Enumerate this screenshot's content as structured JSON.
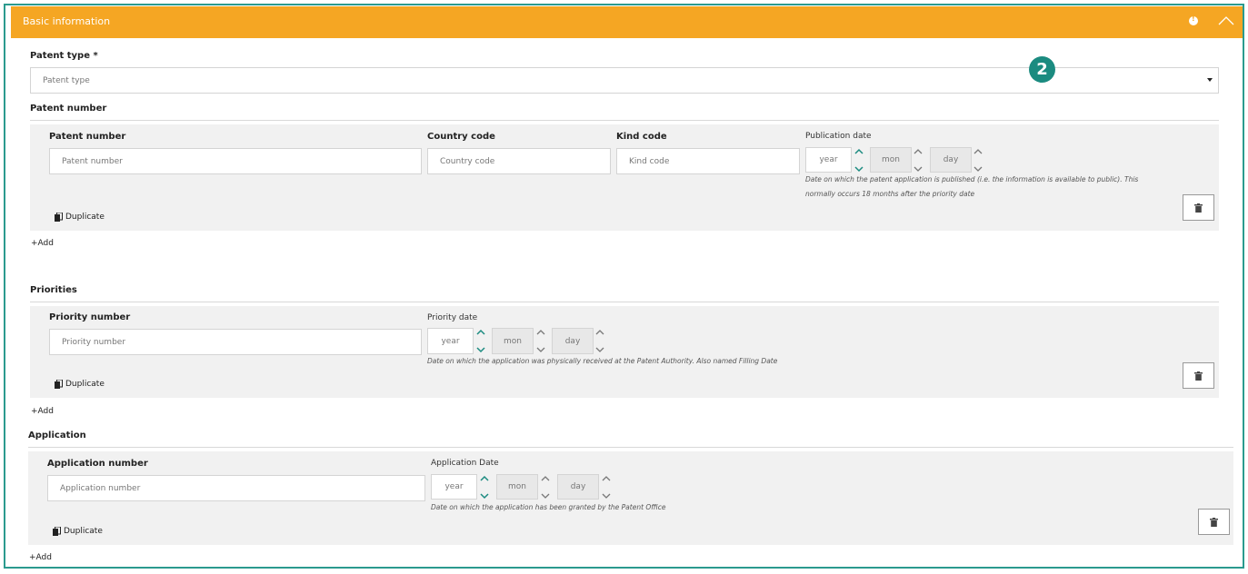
{
  "header": {
    "title": "Basic information"
  },
  "badge": {
    "value": "2"
  },
  "patent_type": {
    "label": "Patent type *",
    "placeholder": "Patent type"
  },
  "patent_number_section": {
    "title": "Patent number",
    "patent_number_label": "Patent number",
    "patent_number_placeholder": "Patent number",
    "country_code_label": "Country code",
    "country_code_placeholder": "Country code",
    "kind_code_label": "Kind code",
    "kind_code_placeholder": "Kind code",
    "publication_date_label": "Publication date",
    "year": "year",
    "mon": "mon",
    "day": "day",
    "help": "Date on which the patent application is published (i.e. the information is available to public). This normally occurs 18 months after the priority date",
    "duplicate": "Duplicate",
    "add": "Add"
  },
  "priorities_section": {
    "title": "Priorities",
    "priority_number_label": "Priority number",
    "priority_number_placeholder": "Priority number",
    "priority_date_label": "Priority date",
    "year": "year",
    "mon": "mon",
    "day": "day",
    "help": "Date on which the application was physically received at the Patent Authority. Also named Filling Date",
    "duplicate": "Duplicate",
    "add": "Add"
  },
  "application_section": {
    "title": "Application",
    "application_number_label": "Application number",
    "application_number_placeholder": "Application number",
    "application_date_label": "Application Date",
    "year": "year",
    "mon": "mon",
    "day": "day",
    "help": "Date on which the application has been granted by the Patent Office",
    "duplicate": "Duplicate",
    "add": "Add"
  },
  "icons": {
    "collapse": "chevron-up-icon",
    "info": "info-icon",
    "trash": "trash-icon",
    "copy": "copy-icon",
    "plus": "plus-icon"
  },
  "colors": {
    "accent": "#f5a623",
    "teal": "#2b9a8e",
    "badge": "#1b8b80"
  }
}
